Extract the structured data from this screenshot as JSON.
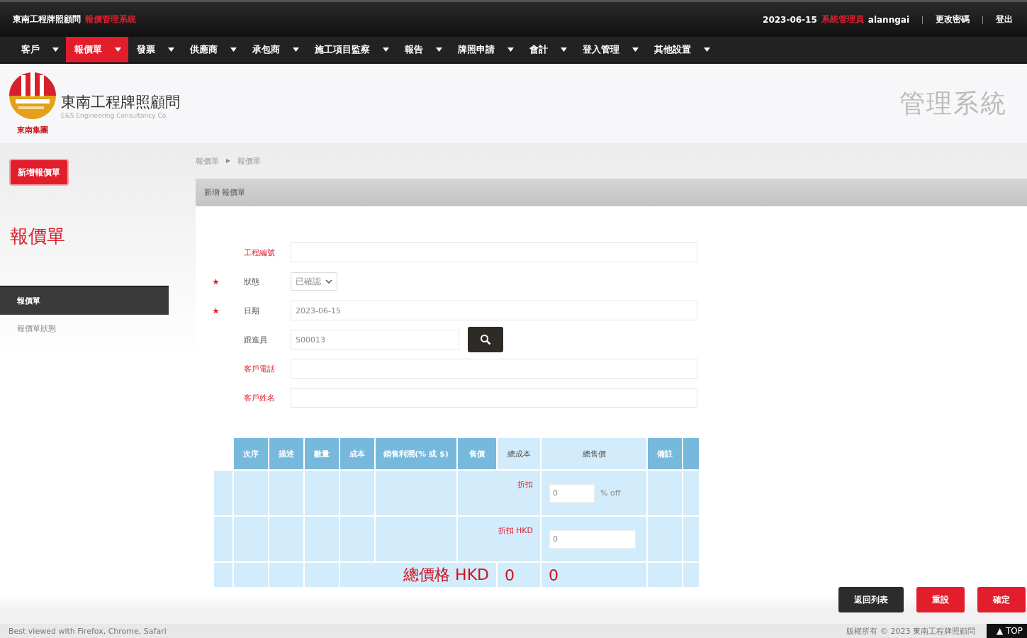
{
  "top_bar": {
    "company": "東南工程牌照顧問",
    "system": "報價管理系統",
    "date": "2023-06-15",
    "role": "系統管理員",
    "user": "alanngai",
    "links": [
      "更改密碼",
      "登出"
    ]
  },
  "nav": [
    {
      "label": "客戶",
      "selected": false
    },
    {
      "label": "報價單",
      "selected": true
    },
    {
      "label": "發票",
      "selected": false
    },
    {
      "label": "供應商",
      "selected": false
    },
    {
      "label": "承包商",
      "selected": false
    },
    {
      "label": "施工項目監察",
      "selected": false
    },
    {
      "label": "報告",
      "selected": false
    },
    {
      "label": "牌照申請",
      "selected": false
    },
    {
      "label": "會計",
      "selected": false
    },
    {
      "label": "登入管理",
      "selected": false
    },
    {
      "label": "其他設置",
      "selected": false
    }
  ],
  "header": {
    "logo_name": "東南工程牌照顧問",
    "logo_english": "E&S Engineering Consultancy Co.",
    "logo_group": "東南集團",
    "title": "管理系統"
  },
  "sidebar": {
    "new_button": "新增報價單",
    "title": "報價單",
    "items": [
      {
        "label": "報價單",
        "selected": true
      },
      {
        "label": "報價單狀態",
        "selected": false
      }
    ]
  },
  "breadcrumb": [
    "報價單",
    "報價單"
  ],
  "panel_title": "新增 報價單",
  "form": [
    {
      "kind": "text",
      "label": "工程編號",
      "required": false,
      "highlight": true
    },
    {
      "kind": "select",
      "label": "狀態",
      "required": true,
      "highlight": false,
      "value": "已確認"
    },
    {
      "kind": "text",
      "label": "日期",
      "required": true,
      "highlight": false,
      "value": "2023-06-15"
    },
    {
      "kind": "lookup",
      "label": "跟進員",
      "required": false,
      "highlight": false,
      "value": "S00013"
    },
    {
      "kind": "text",
      "label": "客戶電話",
      "required": false,
      "highlight": true
    },
    {
      "kind": "text",
      "label": "客戶姓名",
      "required": false,
      "highlight": true
    }
  ],
  "table": {
    "columns": [
      {
        "label": "次序",
        "light": false
      },
      {
        "label": "描述",
        "light": false
      },
      {
        "label": "數量",
        "light": false
      },
      {
        "label": "成本",
        "light": false
      },
      {
        "label": "銷售利潤(% 或 $)",
        "light": false
      },
      {
        "label": "售價",
        "light": false
      },
      {
        "label": "總成本",
        "light": true
      },
      {
        "label": "總售價",
        "light": true
      },
      {
        "label": "備註",
        "light": false
      }
    ],
    "discount_percent": {
      "label": "折扣",
      "value": "0",
      "unit": "% off"
    },
    "discount_amount": {
      "label": "折扣 HKD",
      "value": "0"
    },
    "total": {
      "label": "總價格 HKD",
      "cost": "0",
      "price": "0"
    }
  },
  "actions": [
    {
      "label": "返回列表",
      "kind": "dark"
    },
    {
      "label": "重設",
      "kind": "red"
    },
    {
      "label": "確定",
      "kind": "red"
    }
  ],
  "footer": {
    "browsers": "Best viewed with Firefox, Chrome, Safari",
    "copyright": "版權所有 © 2023 東南工程牌照顧問",
    "top": "▲ TOP"
  }
}
